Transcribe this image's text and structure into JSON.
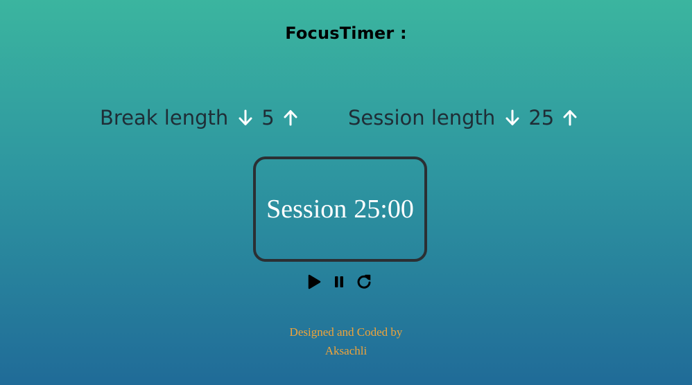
{
  "app": {
    "title": "FocusTimer :"
  },
  "break": {
    "label": "Break length",
    "value": "5",
    "decrement_icon": "arrow-down-icon",
    "increment_icon": "arrow-up-icon"
  },
  "session": {
    "label": "Session length",
    "value": "25",
    "decrement_icon": "arrow-down-icon",
    "increment_icon": "arrow-up-icon"
  },
  "timer": {
    "label": "Session",
    "time": "25:00"
  },
  "player": {
    "play_icon": "play-icon",
    "pause_icon": "pause-icon",
    "reset_icon": "refresh-icon"
  },
  "footer": {
    "line1": "Designed and Coded by",
    "line2": "Aksachli"
  },
  "colors": {
    "gradient_top": "#3bb59f",
    "gradient_bottom": "#206b98",
    "text_dark": "#1f2d36",
    "arrow": "#ffffff",
    "clock_text": "#ffffff",
    "clock_border": "#2b2f33",
    "footer_text": "#f0a43a"
  }
}
